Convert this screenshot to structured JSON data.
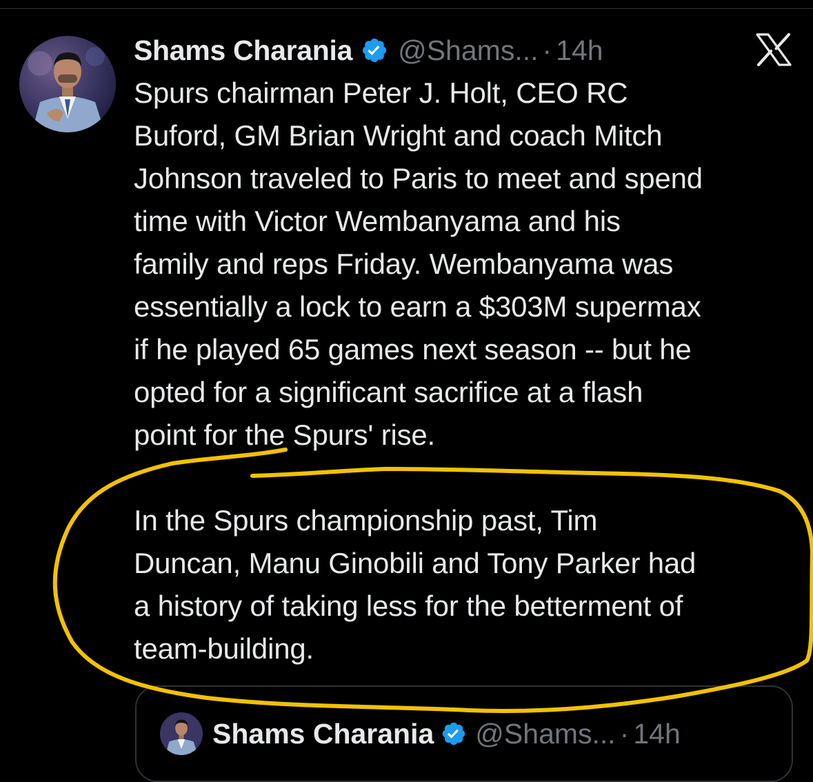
{
  "tweet": {
    "author": {
      "name": "Shams Charania",
      "handle": "@Shams...",
      "verified_color": "#1d9bf0"
    },
    "separator": "·",
    "time": "14h",
    "platform_icon": "x-logo-icon",
    "paragraphs": [
      "Spurs chairman Peter J. Holt, CEO RC\nBuford, GM Brian Wright and coach Mitch\nJohnson traveled to Paris to meet and spend\ntime with Victor Wembanyama and his\nfamily and reps Friday. Wembanyama was\nessentially a lock to earn a $303M supermax\nif he played 65 games next season -- but he\nopted for a significant sacrifice at a flash\npoint for the Spurs' rise.",
      "In the Spurs championship past, Tim\nDuncan, Manu Ginobili and Tony Parker had\na history of taking less for the betterment of\nteam-building."
    ]
  },
  "quoted_tweet": {
    "author": {
      "name": "Shams Charania",
      "handle": "@Shams..."
    },
    "separator": "·",
    "time": "14h"
  },
  "colors": {
    "background": "#000000",
    "text": "#e7e9ea",
    "secondary_text": "#71767b",
    "annotation": "#f2c200",
    "verified": "#1d9bf0"
  }
}
